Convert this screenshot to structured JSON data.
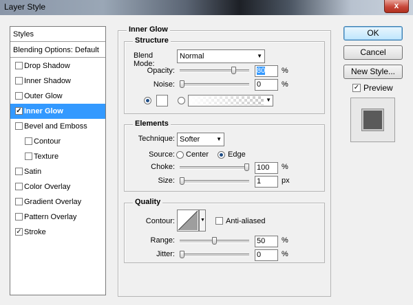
{
  "window": {
    "title": "Layer Style",
    "close_label": "x"
  },
  "styles_list": {
    "header": "Styles",
    "blending": "Blending Options: Default",
    "items": [
      {
        "label": "Drop Shadow",
        "checked": false
      },
      {
        "label": "Inner Shadow",
        "checked": false
      },
      {
        "label": "Outer Glow",
        "checked": false
      },
      {
        "label": "Inner Glow",
        "checked": true
      },
      {
        "label": "Bevel and Emboss",
        "checked": false
      },
      {
        "label": "Contour",
        "checked": false
      },
      {
        "label": "Texture",
        "checked": false
      },
      {
        "label": "Satin",
        "checked": false
      },
      {
        "label": "Color Overlay",
        "checked": false
      },
      {
        "label": "Gradient Overlay",
        "checked": false
      },
      {
        "label": "Pattern Overlay",
        "checked": false
      },
      {
        "label": "Stroke",
        "checked": true
      }
    ],
    "checkmark": "✓"
  },
  "inner_glow": {
    "title": "Inner Glow",
    "structure": {
      "title": "Structure",
      "blend_mode_label": "Blend Mode:",
      "blend_mode_value": "Normal",
      "opacity_label": "Opacity:",
      "opacity_value": "80",
      "noise_label": "Noise:",
      "noise_value": "0",
      "percent": "%",
      "opacity_level": 0.8,
      "noise_level": 0
    },
    "elements": {
      "title": "Elements",
      "technique_label": "Technique:",
      "technique_value": "Softer",
      "source_label": "Source:",
      "source_center": "Center",
      "source_edge": "Edge",
      "choke_label": "Choke:",
      "choke_value": "100",
      "size_label": "Size:",
      "size_value": "1",
      "px": "px",
      "choke_level": 1.0,
      "size_level": 0
    },
    "quality": {
      "title": "Quality",
      "contour_label": "Contour:",
      "anti_aliased_label": "Anti-aliased",
      "range_label": "Range:",
      "range_value": "50",
      "jitter_label": "Jitter:",
      "jitter_value": "0",
      "range_level": 0.5,
      "jitter_level": 0
    }
  },
  "actions": {
    "ok": "OK",
    "cancel": "Cancel",
    "new_style": "New Style...",
    "preview_label": "Preview",
    "preview_checked": true
  }
}
